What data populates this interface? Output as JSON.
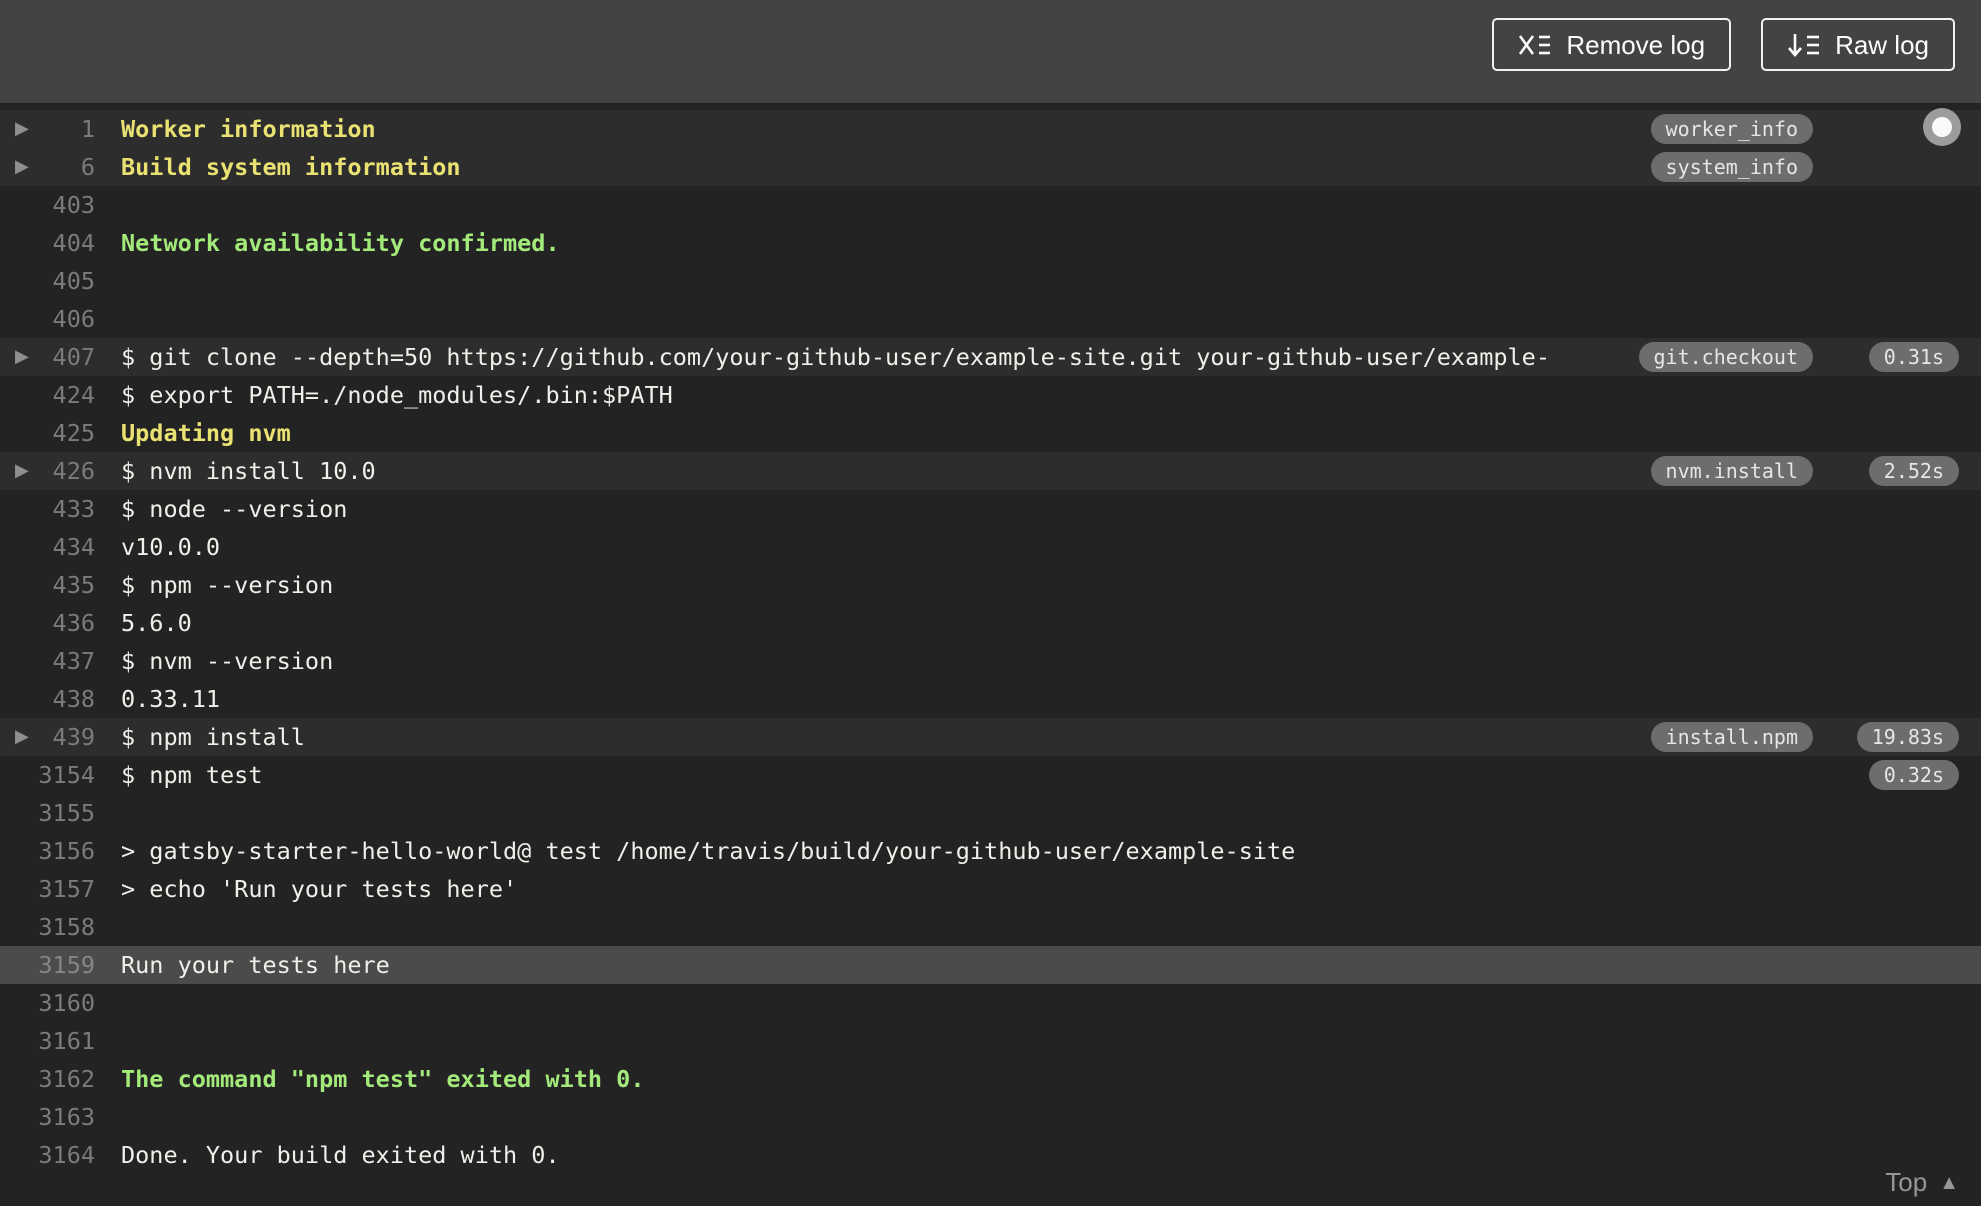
{
  "toolbar": {
    "remove_log_label": "Remove log",
    "raw_log_label": "Raw log"
  },
  "footer": {
    "top_label": "Top"
  },
  "colors": {
    "header_bg": "#434343",
    "log_bg": "#232323",
    "fold_row_bg": "#2d2d2d",
    "highlight_row_bg": "#4b4b4b",
    "text_white": "#f1efe9",
    "text_yellow": "#e9e171",
    "text_green": "#a3ea7b",
    "line_number_gray": "#7b7b7b",
    "badge_bg": "#6d6d6d",
    "badge_text": "#e6e6e6"
  },
  "log": {
    "rows": [
      {
        "num": "1",
        "text": "Worker information",
        "style": "yellow",
        "fold": true,
        "arrow": true,
        "tag": "worker_info"
      },
      {
        "num": "6",
        "text": "Build system information",
        "style": "yellow",
        "fold": true,
        "arrow": true,
        "tag": "system_info"
      },
      {
        "num": "403",
        "text": ""
      },
      {
        "num": "404",
        "text": "Network availability confirmed.",
        "style": "green"
      },
      {
        "num": "405",
        "text": ""
      },
      {
        "num": "406",
        "text": ""
      },
      {
        "num": "407",
        "text": "$ git clone --depth=50 https://github.com/your-github-user/example-site.git your-github-user/example-",
        "fold": true,
        "arrow": true,
        "tag": "git.checkout",
        "time": "0.31s"
      },
      {
        "num": "424",
        "text": "$ export PATH=./node_modules/.bin:$PATH"
      },
      {
        "num": "425",
        "text": "Updating nvm",
        "style": "yellow"
      },
      {
        "num": "426",
        "text": "$ nvm install 10.0",
        "fold": true,
        "arrow": true,
        "tag": "nvm.install",
        "time": "2.52s"
      },
      {
        "num": "433",
        "text": "$ node --version"
      },
      {
        "num": "434",
        "text": "v10.0.0"
      },
      {
        "num": "435",
        "text": "$ npm --version"
      },
      {
        "num": "436",
        "text": "5.6.0"
      },
      {
        "num": "437",
        "text": "$ nvm --version"
      },
      {
        "num": "438",
        "text": "0.33.11"
      },
      {
        "num": "439",
        "text": "$ npm install",
        "fold": true,
        "arrow": true,
        "tag": "install.npm",
        "time": "19.83s"
      },
      {
        "num": "3154",
        "text": "$ npm test",
        "time": "0.32s"
      },
      {
        "num": "3155",
        "text": ""
      },
      {
        "num": "3156",
        "text": "> gatsby-starter-hello-world@ test /home/travis/build/your-github-user/example-site"
      },
      {
        "num": "3157",
        "text": "> echo 'Run your tests here'"
      },
      {
        "num": "3158",
        "text": ""
      },
      {
        "num": "3159",
        "text": "Run your tests here",
        "highlight": true
      },
      {
        "num": "3160",
        "text": ""
      },
      {
        "num": "3161",
        "text": ""
      },
      {
        "num": "3162",
        "text": "The command \"npm test\" exited with 0.",
        "style": "green"
      },
      {
        "num": "3163",
        "text": ""
      },
      {
        "num": "3164",
        "text": "Done. Your build exited with 0."
      }
    ]
  }
}
